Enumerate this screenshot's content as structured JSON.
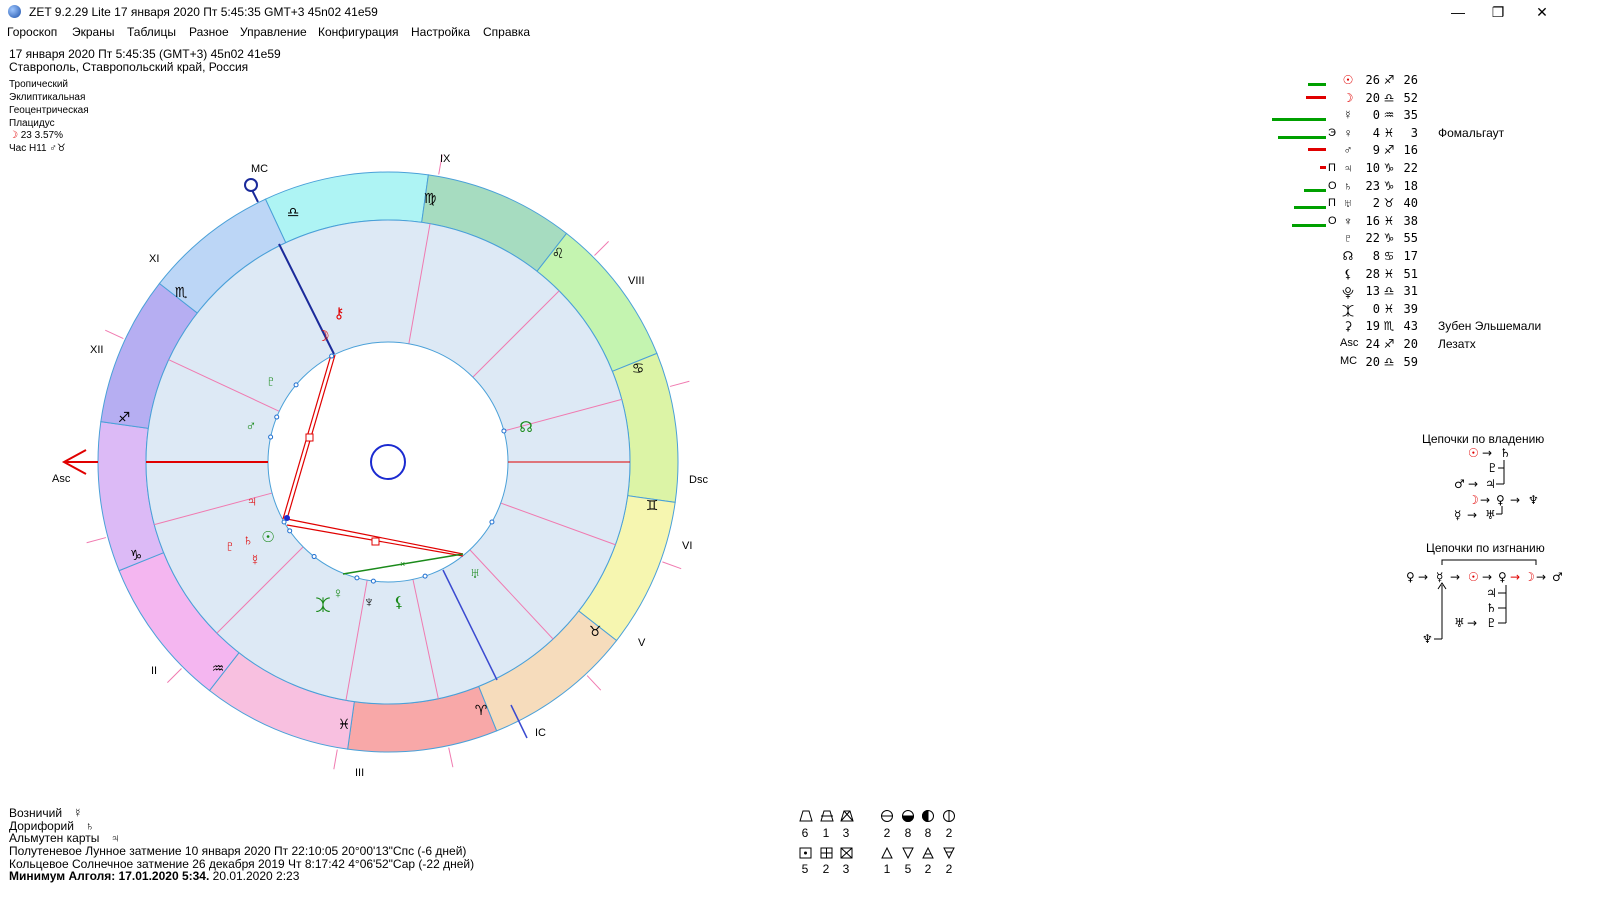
{
  "window": {
    "title": "ZET 9.2.29 Lite   17 января 2020  Пт   5:45:35 GMT+3 45n02  41e59",
    "minimize": "—",
    "maximize": "❐",
    "close": "✕"
  },
  "menu": [
    "Гороскоп",
    "Экраны",
    "Таблицы",
    "Разное",
    "Управление",
    "Конфигурация",
    "Настройка",
    "Справка"
  ],
  "info": {
    "line1": "17 января 2020  Пт   5:45:35 (GMT+3) 45n02  41e59",
    "line2": "Ставрополь, Ставропольский край, Россия",
    "zodiac": "Тропический",
    "coords": "Эклиптикальная",
    "center": "Геоцентрическая",
    "houses": "Плацидус",
    "moon_phase": "23 3.57%",
    "hour": "Час H11"
  },
  "chart": {
    "house_labels": [
      "IX",
      "VIII",
      "Dsc",
      "VI",
      "V",
      "IC",
      "III",
      "II",
      "Asc",
      "XII",
      "XI",
      "MC"
    ],
    "signs": [
      "♎",
      "♍",
      "♌",
      "♋",
      "♊",
      "♉",
      "♈",
      "♓",
      "♒",
      "♑",
      "♐",
      "♏"
    ],
    "sign_colors": [
      "#aef4f4",
      "#a6dcc0",
      "#c4f4b0",
      "#dcf4a6",
      "#f6f6b0",
      "#f6dcbc",
      "#f8a8a8",
      "#f8c0e0",
      "#f4b6f0",
      "#dcbaf6",
      "#b6aef2",
      "#bcd6f6"
    ]
  },
  "planets": [
    {
      "glyph": "☉",
      "deg": "26",
      "sign": "♐",
      "min": "26",
      "marker": "",
      "star": ""
    },
    {
      "glyph": "☽",
      "deg": "20",
      "sign": "♎",
      "min": "52",
      "marker": "",
      "star": ""
    },
    {
      "glyph": "☿",
      "deg": "0",
      "sign": "♒",
      "min": "35",
      "marker": "",
      "star": ""
    },
    {
      "glyph": "♀",
      "deg": "4",
      "sign": "♓",
      "min": "3",
      "marker": "Э",
      "star": "Фомальгаут"
    },
    {
      "glyph": "♂",
      "deg": "9",
      "sign": "♐",
      "min": "16",
      "marker": "",
      "star": ""
    },
    {
      "glyph": "♃",
      "deg": "10",
      "sign": "♑",
      "min": "22",
      "marker": "П",
      "star": ""
    },
    {
      "glyph": "♄",
      "deg": "23",
      "sign": "♑",
      "min": "18",
      "marker": "О",
      "star": ""
    },
    {
      "glyph": "♅",
      "deg": "2",
      "sign": "♉",
      "min": "40",
      "marker": "П",
      "star": ""
    },
    {
      "glyph": "♆",
      "deg": "16",
      "sign": "♓",
      "min": "38",
      "marker": "О",
      "star": ""
    },
    {
      "glyph": "♇",
      "deg": "22",
      "sign": "♑",
      "min": "55",
      "marker": "",
      "star": ""
    },
    {
      "glyph": "☊",
      "deg": "8",
      "sign": "♋",
      "min": "17",
      "marker": "",
      "star": ""
    },
    {
      "glyph": "⚸",
      "deg": "28",
      "sign": "♓",
      "min": "51",
      "marker": "",
      "star": ""
    },
    {
      "glyph": "⯓",
      "deg": "13",
      "sign": "♎",
      "min": "31",
      "marker": "",
      "star": ""
    },
    {
      "glyph": "⯰",
      "deg": "0",
      "sign": "♓",
      "min": "39",
      "marker": "",
      "star": ""
    },
    {
      "glyph": "⚳",
      "deg": "19",
      "sign": "♏",
      "min": "43",
      "marker": "",
      "star": "Зубен Эльшемали"
    },
    {
      "glyph": "Asc",
      "deg": "24",
      "sign": "♐",
      "min": "20",
      "marker": "",
      "star": "Лезатх"
    },
    {
      "glyph": "MC",
      "deg": "20",
      "sign": "♎",
      "min": "59",
      "marker": "",
      "star": ""
    }
  ],
  "chains": {
    "ownership_title": "Цепочки по владению",
    "exile_title": "Цепочки по изгнанию"
  },
  "bottom": {
    "voznich": "Возничий",
    "dorifory": "Дорифорий",
    "almuten": "Альмутен карты",
    "lunar": "Полутеневое Лунное затмение 10 января 2020 Пт 22:10:05 20°00'13\"Спс (-6 дней)",
    "solar": "Кольцевое Солнечное затмение 26 декабря 2019 Чт  8:17:42  4°06'52\"Сар (-22 дней)",
    "algol_bold": "Минимум Алголя: 17.01.2020  5:34.",
    "algol_rest": "  20.01.2020  2:23"
  },
  "stats": {
    "top_row": [
      "6",
      "1",
      "3",
      "2",
      "8",
      "8",
      "2"
    ],
    "bottom_row": [
      "5",
      "2",
      "3",
      "1",
      "5",
      "2",
      "2"
    ]
  },
  "colors": {
    "accent_red": "#e00000",
    "planet_green": "#1a8a1a",
    "ring_blue": "#1e6fd0",
    "bar_green": "#00a000"
  }
}
